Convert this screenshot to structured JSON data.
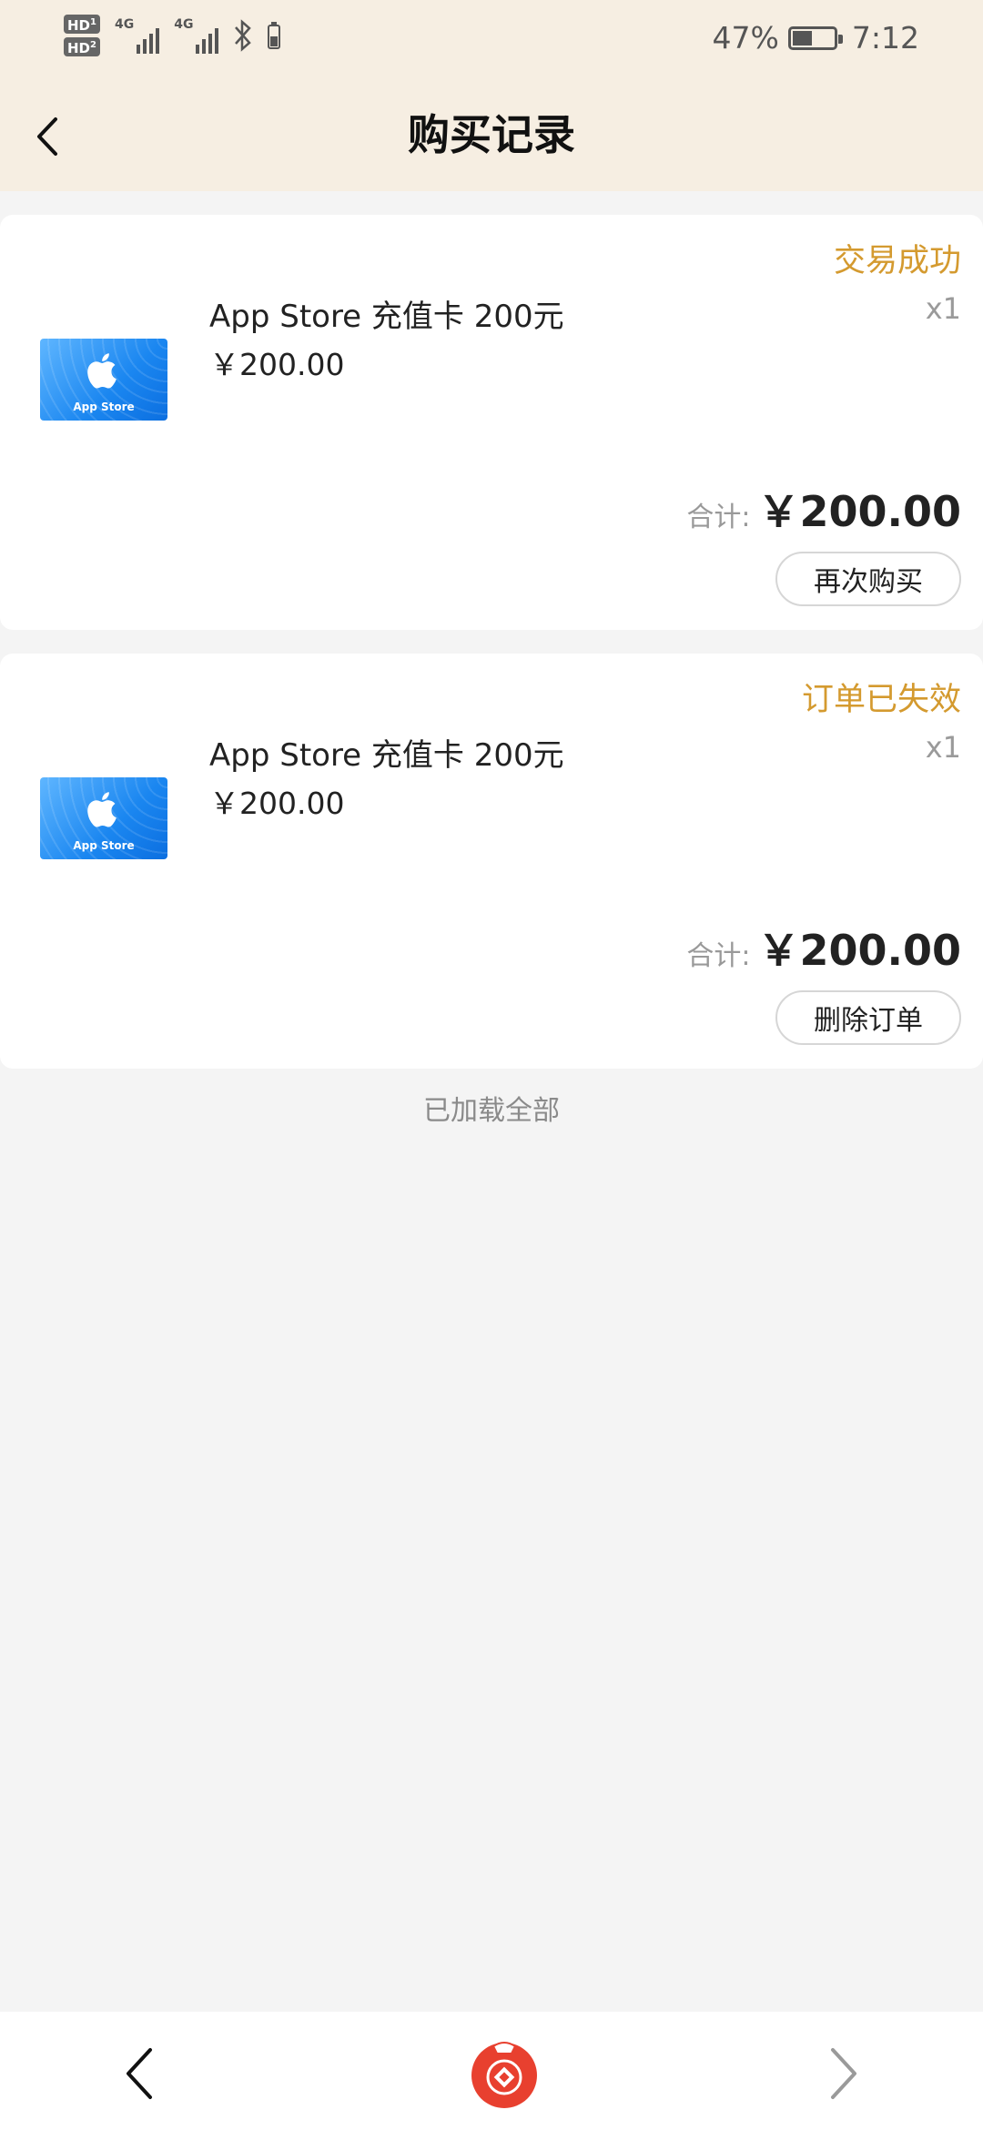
{
  "status_bar": {
    "sim1": "HD",
    "sim1_index": "1",
    "sim2": "HD",
    "sim2_index": "2",
    "net1": "4G",
    "net2": "4G",
    "battery_percent_text": "47%",
    "battery_level": 0.47,
    "time": "7:12",
    "icons": [
      "bluetooth-icon",
      "battery-icon",
      "signal-icon"
    ]
  },
  "header": {
    "title": "购买记录",
    "back_icon": "chevron-left-icon"
  },
  "orders": [
    {
      "status": "交易成功",
      "product_name": "App Store 充值卡 200元",
      "quantity": "x1",
      "unit_price": "￥200.00",
      "total_label": "合计:",
      "total_amount": "￥200.00",
      "action_label": "再次购买",
      "thumbnail_label": "App Store"
    },
    {
      "status": "订单已失效",
      "product_name": "App Store 充值卡 200元",
      "quantity": "x1",
      "unit_price": "￥200.00",
      "total_label": "合计:",
      "total_amount": "￥200.00",
      "action_label": "删除订单",
      "thumbnail_label": "App Store"
    }
  ],
  "footer_text": "已加载全部",
  "bottom_nav": {
    "icons": [
      "back-icon",
      "home-lucky-bag-icon",
      "forward-icon"
    ]
  },
  "colors": {
    "header_bg": "#f6eee2",
    "status_accent": "#d49a2f",
    "page_bg": "#f4f4f4"
  }
}
